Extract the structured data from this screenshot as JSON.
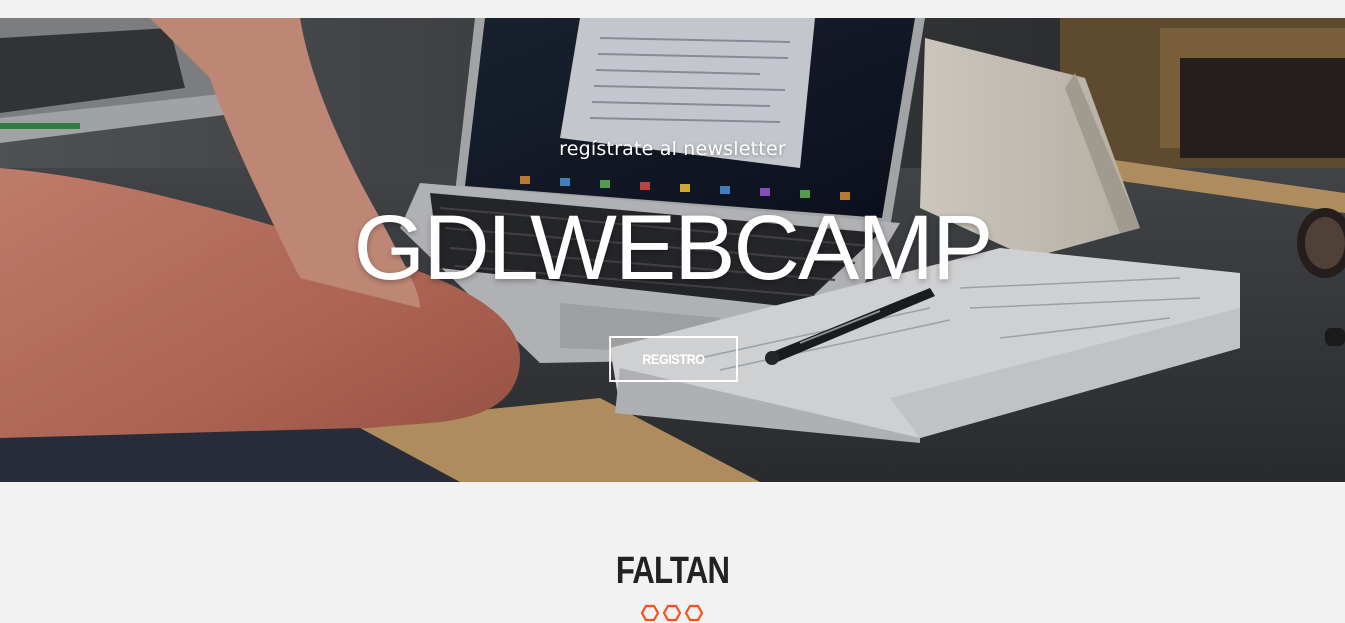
{
  "hero": {
    "subtitle": "regístrate al newsletter",
    "title": "GDLWEBCAMP",
    "button_label": "REGISTRO"
  },
  "countdown_section": {
    "title": "FALTAN",
    "decoration_icons": [
      "hexagon-icon",
      "hexagon-icon",
      "hexagon-icon"
    ]
  },
  "colors": {
    "accent": "#f4511e",
    "background": "#f2f2f2",
    "heading": "#222222",
    "hero_text": "#ffffff"
  }
}
